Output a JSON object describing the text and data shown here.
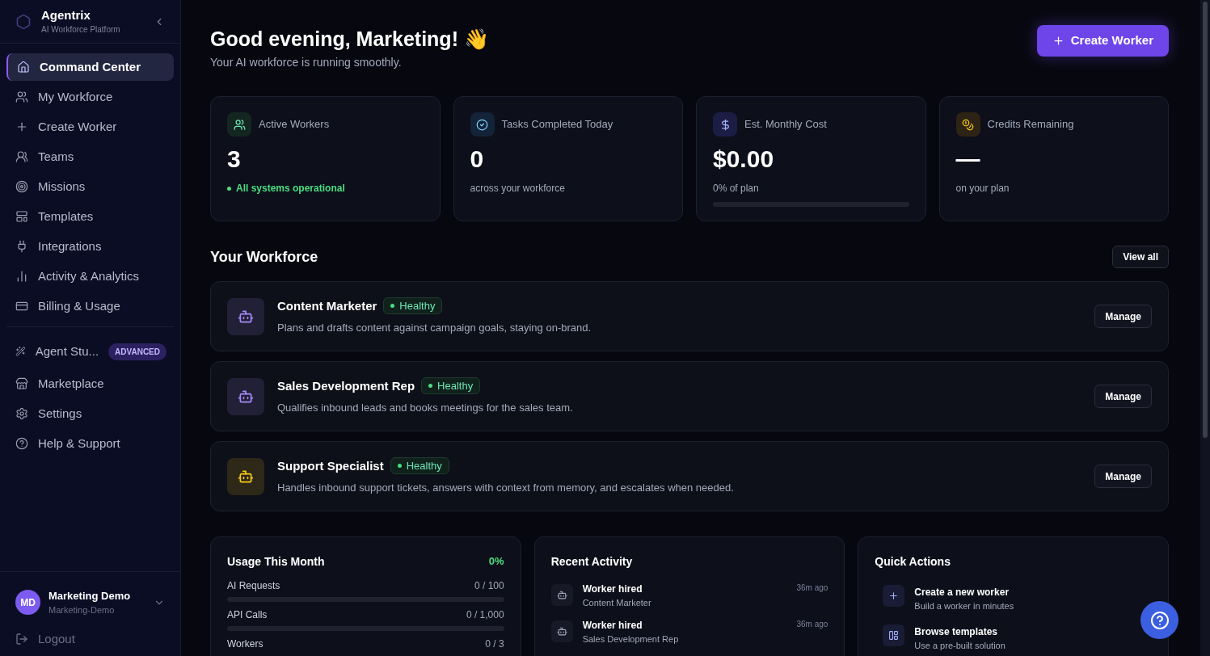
{
  "sidebar": {
    "brand": {
      "name": "Agentrix",
      "subtitle": "AI Workforce Platform"
    },
    "groups": [
      [
        {
          "label": "Command Center",
          "selected": true
        },
        {
          "label": "My Workforce",
          "selected": false
        },
        {
          "label": "Create Worker",
          "selected": false
        },
        {
          "label": "Teams",
          "selected": false
        },
        {
          "label": "Missions",
          "selected": false
        },
        {
          "label": "Templates",
          "selected": false
        },
        {
          "label": "Integrations",
          "selected": false
        },
        {
          "label": "Activity & Analytics",
          "selected": false
        },
        {
          "label": "Billing & Usage",
          "selected": false
        }
      ],
      [
        {
          "label": "Agent Stu...",
          "selected": false,
          "badge": "ADVANCED"
        },
        {
          "label": "Marketplace",
          "selected": false
        },
        {
          "label": "Settings",
          "selected": false
        },
        {
          "label": "Help & Support",
          "selected": false
        }
      ]
    ],
    "user": {
      "initials": "MD",
      "name": "Marketing Demo",
      "handle": "Marketing-Demo"
    },
    "logout": "Logout"
  },
  "header": {
    "greeting": "Good evening, Marketing! 👋",
    "subtitle": "Your AI workforce is running smoothly.",
    "button": "Create Worker"
  },
  "stats": [
    {
      "label": "Active Workers",
      "value": "3",
      "note": "All systems operational",
      "kind": "status"
    },
    {
      "label": "Tasks Completed Today",
      "value": "0",
      "note": "across your workforce",
      "kind": "plain"
    },
    {
      "label": "Est. Monthly Cost",
      "value": "$0.00",
      "note": "0% of plan",
      "kind": "progress",
      "level": 0
    },
    {
      "label": "Credits Remaining",
      "value": "—",
      "note": "on your plan",
      "kind": "plain"
    }
  ],
  "workforce": {
    "title": "Your Workforce",
    "view_all": "View all",
    "workers": [
      {
        "name": "Content Marketer",
        "status": "Healthy",
        "description": "Plans and drafts content against campaign goals, staying on-brand.",
        "color": "#a78bfa",
        "action": "Manage"
      },
      {
        "name": "Sales Development Rep",
        "status": "Healthy",
        "description": "Qualifies inbound leads and books meetings for the sales team.",
        "color": "#a78bfa",
        "action": "Manage"
      },
      {
        "name": "Support Specialist",
        "status": "Healthy",
        "description": "Handles inbound support tickets, answers with context from memory, and escalates when needed.",
        "color": "#facc15",
        "action": "Manage"
      }
    ]
  },
  "usage": {
    "title": "Usage This Month",
    "percent": "0%",
    "rows": [
      {
        "label": "AI Requests",
        "reading": "0 / 100",
        "level": 0
      },
      {
        "label": "API Calls",
        "reading": "0 / 1,000",
        "level": 0
      },
      {
        "label": "Workers",
        "reading": "0 / 3"
      }
    ]
  },
  "activity": {
    "title": "Recent Activity",
    "items": [
      {
        "title": "Worker hired",
        "subtitle": "Content Marketer",
        "time": "36m ago"
      },
      {
        "title": "Worker hired",
        "subtitle": "Sales Development Rep",
        "time": "36m ago"
      }
    ]
  },
  "quick_actions": {
    "title": "Quick Actions",
    "items": [
      {
        "title": "Create a new worker",
        "subtitle": "Build a worker in minutes"
      },
      {
        "title": "Browse templates",
        "subtitle": "Use a pre-built solution"
      }
    ]
  }
}
